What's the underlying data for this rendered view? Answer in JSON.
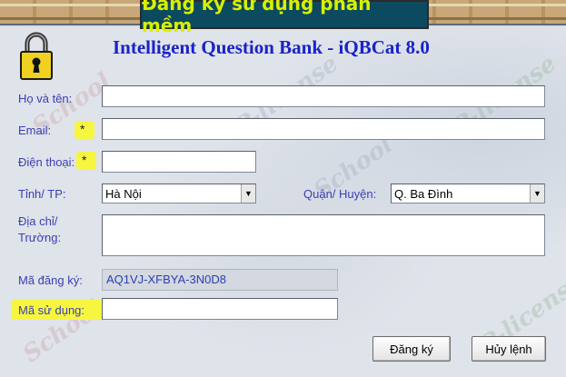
{
  "window": {
    "banner_title": "Đăng ký sử dụng phần mềm",
    "app_title": "Intelligent Question Bank - iQBCat 8.0"
  },
  "form": {
    "name_label": "Họ và tên:",
    "name_value": "",
    "email_label": "Email:",
    "email_required": "*",
    "email_value": "",
    "phone_label": "Điện thoại:",
    "phone_required": "*",
    "phone_value": "",
    "province_label": "Tỉnh/ TP:",
    "province_value": "Hà Nội",
    "district_label": "Quận/ Huyện:",
    "district_value": "Q. Ba Đình",
    "address_label_line1": "Địa chỉ/",
    "address_label_line2": "Trường:",
    "address_value": "",
    "reg_code_label": "Mã đăng ký:",
    "reg_code_value": "AQ1VJ-XFBYA-3N0D8",
    "use_code_label": "Mã sử dụng:",
    "use_code_value": ""
  },
  "buttons": {
    "register": "Đăng ký",
    "cancel": "Hủy lệnh"
  },
  "watermarks": {
    "school": "School",
    "license": "P-license"
  },
  "colors": {
    "label": "#3a40b0",
    "title": "#1a22c8",
    "banner_bg": "#0c4a60",
    "banner_text": "#d8f000",
    "highlight": "#f6f640"
  }
}
